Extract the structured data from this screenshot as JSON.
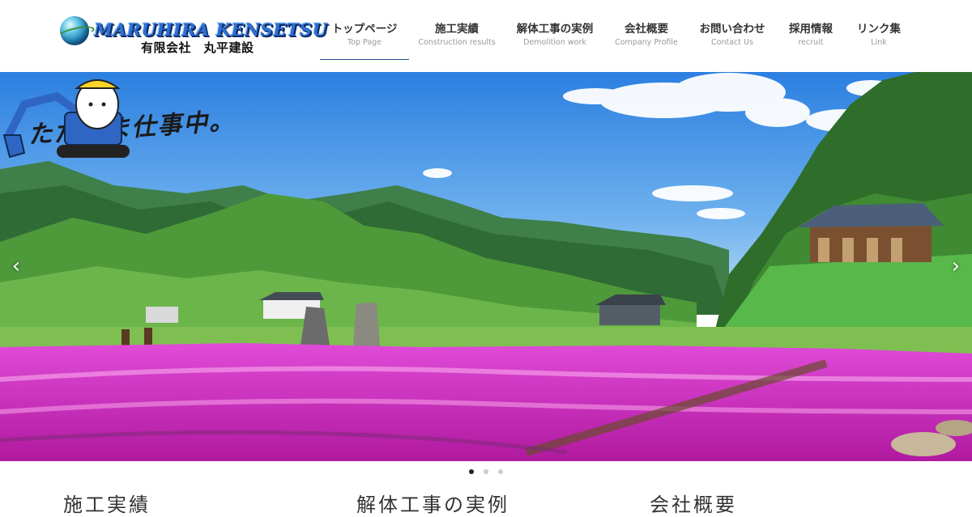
{
  "logo": {
    "name_en": "MARUHIRA KENSETSU",
    "name_jp": "有限会社　丸平建設"
  },
  "nav": [
    {
      "jp": "トップページ",
      "en": "Top Page",
      "active": true
    },
    {
      "jp": "施工実績",
      "en": "Construction results",
      "active": false
    },
    {
      "jp": "解体工事の実例",
      "en": "Demolition work",
      "active": false
    },
    {
      "jp": "会社概要",
      "en": "Company Profile",
      "active": false
    },
    {
      "jp": "お問い合わせ",
      "en": "Contact Us",
      "active": false
    },
    {
      "jp": "採用情報",
      "en": "recruit",
      "active": false
    },
    {
      "jp": "リンク集",
      "en": "Link",
      "active": false
    }
  ],
  "hero": {
    "slogan": "ただいま仕事中。",
    "prev_icon": "chevron-left-icon",
    "next_icon": "chevron-right-icon",
    "slides_count": 3,
    "active_slide": 1
  },
  "sections": {
    "works_title": "施工実績",
    "demolition_title": "解体工事の実例",
    "profile_title": "会社概要"
  },
  "colors": {
    "accent": "#1b4a8c",
    "sky": "#3f8fe0",
    "flowers": "#d236c6"
  }
}
